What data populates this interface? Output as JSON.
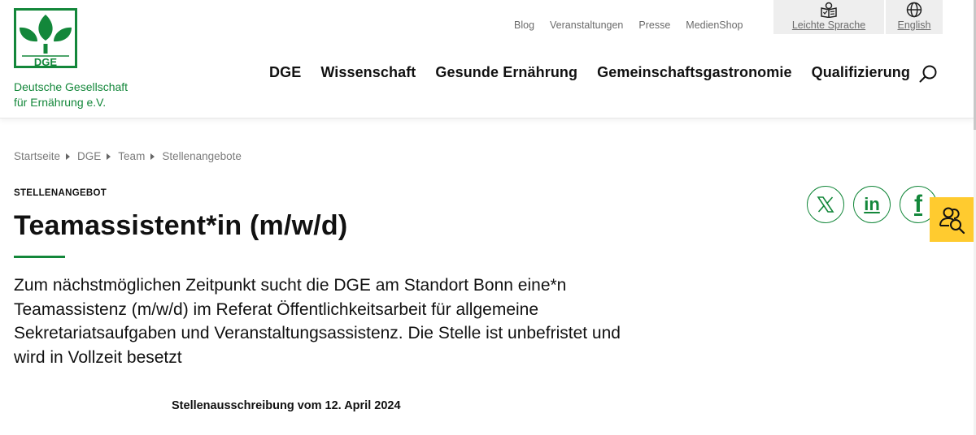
{
  "brand": {
    "logo_text": "DGE",
    "org_line1": "Deutsche Gesellschaft",
    "org_line2": "für Ernährung e.V.",
    "color_green": "#13873a",
    "color_yellow": "#ffcb2f"
  },
  "meta_nav": {
    "items": [
      {
        "label": "Blog"
      },
      {
        "label": "Veranstaltungen"
      },
      {
        "label": "Presse"
      },
      {
        "label": "MedienShop"
      }
    ]
  },
  "utility": {
    "easy_language": {
      "label": "Leichte Sprache",
      "icon": "easy-language-book-icon"
    },
    "language": {
      "label": "English",
      "icon": "globe-icon"
    }
  },
  "main_nav": {
    "items": [
      {
        "label": "DGE"
      },
      {
        "label": "Wissenschaft"
      },
      {
        "label": "Gesunde Ernährung"
      },
      {
        "label": "Gemeinschaftsgastronomie"
      },
      {
        "label": "Qualifizierung"
      }
    ],
    "search_icon": "search-icon"
  },
  "breadcrumb": {
    "items": [
      {
        "label": "Startseite"
      },
      {
        "label": "DGE"
      },
      {
        "label": "Team"
      },
      {
        "label": "Stellenangebote"
      }
    ]
  },
  "article": {
    "kicker": "STELLENANGEBOT",
    "title": "Teamassistent*in (m/w/d)",
    "lead": "Zum nächstmöglichen Zeitpunkt sucht die DGE am Standort Bonn eine*n Teamassistenz (m/w/d) im Referat Öffentlichkeitsarbeit für allgemeine Sekretariatsaufgaben und Veranstaltungsassistenz. Die Stelle ist unbefristet und wird in Vollzeit besetzt",
    "date_line": "Stellenausschreibung vom 12. April 2024"
  },
  "share": {
    "x": {
      "icon": "x-logo-icon"
    },
    "linkedin": {
      "glyph": "in",
      "icon": "linkedin-icon"
    },
    "facebook": {
      "glyph": "f",
      "icon": "facebook-icon"
    }
  },
  "accessibility_button": {
    "icon": "people-search-icon"
  }
}
